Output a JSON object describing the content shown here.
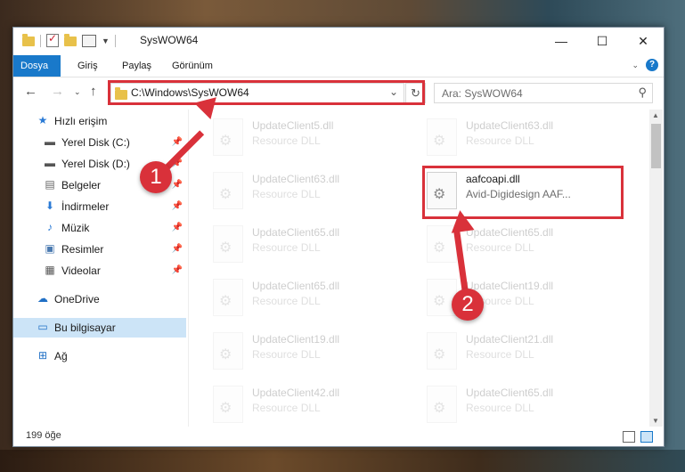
{
  "window": {
    "title": "SysWOW64",
    "controls": {
      "minimize": "—",
      "maximize": "☐",
      "close": "✕"
    }
  },
  "ribbon": {
    "tabs": [
      "Dosya",
      "Giriş",
      "Paylaş",
      "Görünüm"
    ],
    "active_tab": "Dosya"
  },
  "navigation": {
    "address": "C:\\Windows\\SysWOW64",
    "search_placeholder": "Ara: SysWOW64"
  },
  "sidebar": {
    "quick_access": "Hızlı erişim",
    "items": [
      {
        "label": "Yerel Disk (C:)",
        "icon": "drive-icon",
        "pinned": true
      },
      {
        "label": "Yerel Disk (D:)",
        "icon": "drive-icon",
        "pinned": true
      },
      {
        "label": "Belgeler",
        "icon": "documents-icon",
        "pinned": true
      },
      {
        "label": "İndirmeler",
        "icon": "download-icon",
        "pinned": true
      },
      {
        "label": "Müzik",
        "icon": "music-icon",
        "pinned": true
      },
      {
        "label": "Resimler",
        "icon": "pictures-icon",
        "pinned": true
      },
      {
        "label": "Videolar",
        "icon": "videos-icon",
        "pinned": true
      }
    ],
    "onedrive": "OneDrive",
    "this_pc": "Bu bilgisayar",
    "network": "Ağ"
  },
  "files": {
    "left_column": [
      {
        "name": "UpdateClient5.dll",
        "type": "Resource DLL"
      },
      {
        "name": "UpdateClient63.dll",
        "type": "Resource DLL"
      },
      {
        "name": "UpdateClient65.dll",
        "type": "Resource DLL"
      },
      {
        "name": "UpdateClient65.dll",
        "type": "Resource DLL"
      },
      {
        "name": "UpdateClient19.dll",
        "type": "Resource DLL"
      },
      {
        "name": "UpdateClient42.dll",
        "type": "Resource DLL"
      }
    ],
    "right_column": [
      {
        "name": "UpdateClient63.dll",
        "type": "Resource DLL"
      },
      {
        "name": "aafcoapi.dll",
        "type": "Avid-Digidesign AAF...",
        "highlighted": true
      },
      {
        "name": "UpdateClient65.dll",
        "type": "Resource DLL"
      },
      {
        "name": "UpdateClient19.dll",
        "type": "Resource DLL"
      },
      {
        "name": "UpdateClient21.dll",
        "type": "Resource DLL"
      },
      {
        "name": "UpdateClient65.dll",
        "type": "Resource DLL"
      }
    ]
  },
  "status": {
    "item_count": "199 öğe"
  },
  "markers": {
    "step1": "1",
    "step2": "2",
    "accent": "#d9313a"
  },
  "colors": {
    "ribbon_active": "#1979ca",
    "selection": "#cce4f7"
  }
}
